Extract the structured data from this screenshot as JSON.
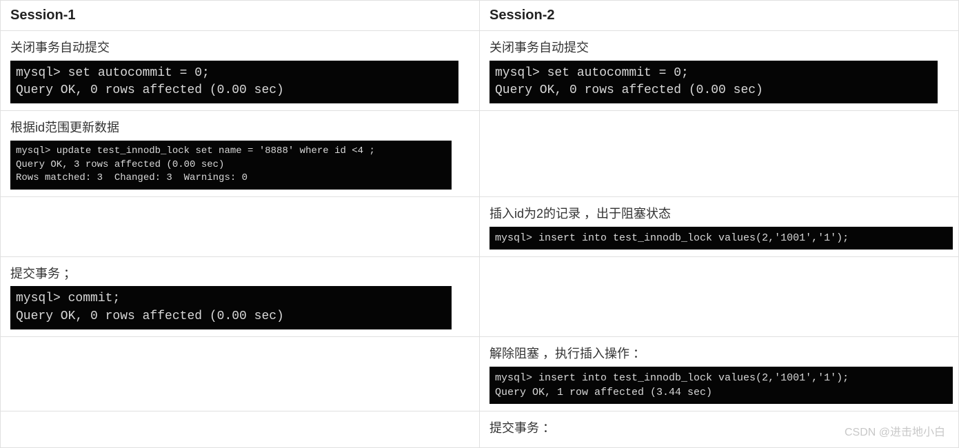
{
  "headers": {
    "s1": "Session-1",
    "s2": "Session-2"
  },
  "rows": [
    {
      "s1": {
        "desc": "关闭事务自动提交",
        "term": "mysql> set autocommit = 0;\nQuery OK, 0 rows affected (0.00 sec)",
        "size": "sz-lg",
        "w": "w-650"
      },
      "s2": {
        "desc": "关闭事务自动提交",
        "term": "mysql> set autocommit = 0;\nQuery OK, 0 rows affected (0.00 sec)",
        "size": "sz-lg",
        "w": "w-650"
      }
    },
    {
      "s1": {
        "desc": "根据id范围更新数据",
        "term": "mysql> update test_innodb_lock set name = '8888' where id <4 ;\nQuery OK, 3 rows affected (0.00 sec)\nRows matched: 3  Changed: 3  Warnings: 0",
        "size": "sz-sm",
        "w": "w-640"
      },
      "s2": null
    },
    {
      "s1": null,
      "s2": {
        "desc": "插入id为2的记录 ，出于阻塞状态",
        "term": "mysql> insert into test_innodb_lock values(2,'1001','1');",
        "size": "sz-md",
        "w": "w-672"
      }
    },
    {
      "s1": {
        "desc": "提交事务 ；",
        "term": "mysql> commit;\nQuery OK, 0 rows affected (0.00 sec)",
        "size": "sz-lg",
        "w": "w-640"
      },
      "s2": null
    },
    {
      "s1": null,
      "s2": {
        "desc": "解除阻塞 ，执行插入操作 ：",
        "term": "mysql> insert into test_innodb_lock values(2,'1001','1');\nQuery OK, 1 row affected (3.44 sec)",
        "size": "sz-md",
        "w": "w-672"
      }
    },
    {
      "s1": null,
      "s2": {
        "desc": "提交事务 ："
      }
    }
  ],
  "watermark": "CSDN @进击地小白"
}
